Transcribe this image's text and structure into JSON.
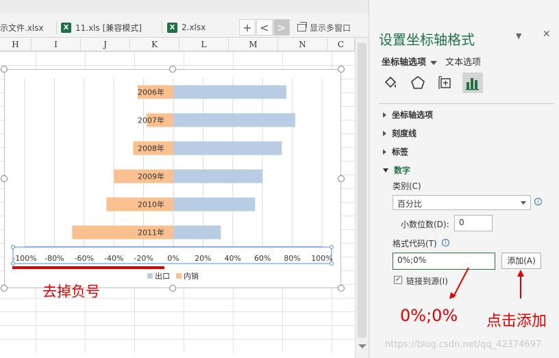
{
  "tabs": [
    {
      "label": "示文件.xlsx",
      "icon": null
    },
    {
      "label": "11.xls  [兼容模式]",
      "icon": "X"
    },
    {
      "label": "2.xlsx",
      "icon": "X"
    }
  ],
  "tab_buttons": {
    "add": "+",
    "prev": "<",
    "next": ">"
  },
  "multi_window": "显示多窗口",
  "columns": [
    "H",
    "I",
    "J",
    "K",
    "L",
    "M",
    "N",
    "C"
  ],
  "chart_data": {
    "type": "bar",
    "orientation": "horizontal",
    "categories": [
      "2006年",
      "2007年",
      "2008年",
      "2009年",
      "2010年",
      "2011年"
    ],
    "series": [
      {
        "name": "出口",
        "values": [
          0.76,
          0.82,
          0.73,
          0.6,
          0.55,
          0.32
        ],
        "color": "#b8cce4"
      },
      {
        "name": "内销",
        "values": [
          -0.24,
          -0.18,
          -0.27,
          -0.4,
          -0.45,
          -0.68
        ],
        "color": "#fac090"
      }
    ],
    "xlim": [
      -1.0,
      1.0
    ],
    "x_ticks": [
      "-100%",
      "-80%",
      "-60%",
      "-40%",
      "-20%",
      "0%",
      "20%",
      "40%",
      "60%",
      "80%",
      "100%"
    ],
    "grid": true,
    "legend": "bottom"
  },
  "annotations": {
    "remove_negative": "去掉负号",
    "format_example": "0%;0%",
    "click_add": "点击添加"
  },
  "pane": {
    "title": "设置坐标轴格式",
    "tab_axis": "坐标轴选项",
    "tab_text": "文本选项",
    "close": "✕",
    "sections": {
      "axis_options": "坐标轴选项",
      "tick_marks": "刻度线",
      "labels": "标签",
      "number": "数字"
    },
    "category_label": "类别(C)",
    "category_value": "百分比",
    "decimals_label": "小数位数(D):",
    "decimals_value": "0",
    "format_code_label": "格式代码(T)",
    "format_code_value": "0%;0%",
    "add_button": "添加(A)",
    "link_source_label": "链接到源(I)",
    "link_source_checked": "✓"
  },
  "watermark": "https://blog.csdn.net/qq_42374697"
}
